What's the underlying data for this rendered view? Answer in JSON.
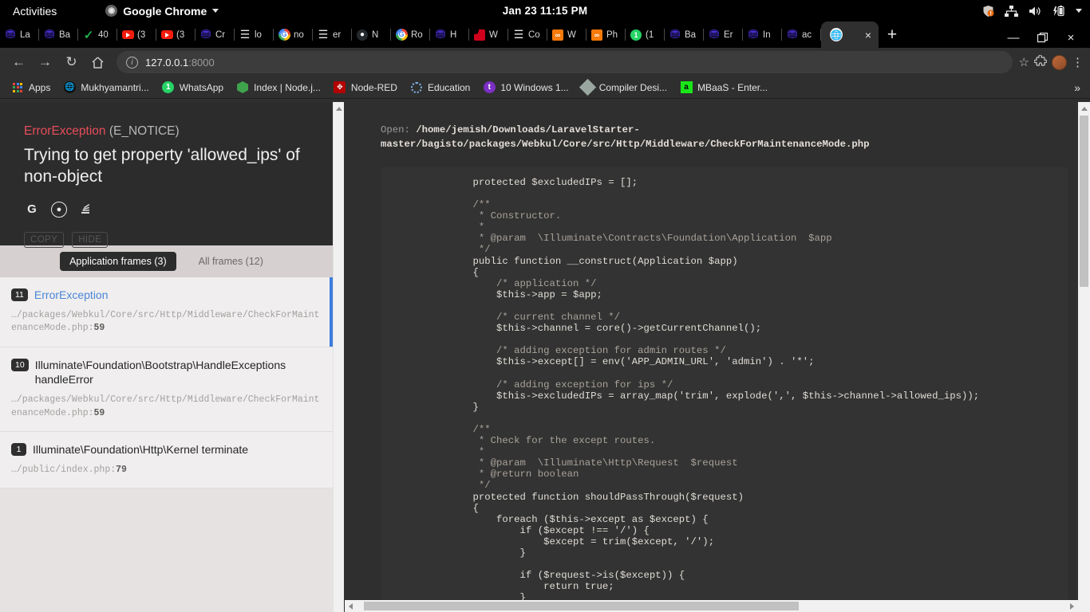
{
  "desktop": {
    "activities": "Activities",
    "app_menu": "Google Chrome",
    "clock": "Jan 23  11:15 PM",
    "tray_icons": [
      "shield-alert-icon",
      "network-icon",
      "volume-icon",
      "battery-charging-icon",
      "dropdown-arrow-icon"
    ]
  },
  "browser": {
    "tabs": [
      {
        "label": "La",
        "icon": "castle-favicon"
      },
      {
        "label": "Ba",
        "icon": "castle-favicon"
      },
      {
        "label": "40",
        "icon": "green-check-favicon"
      },
      {
        "label": "(3",
        "icon": "youtube-favicon"
      },
      {
        "label": "(3",
        "icon": "youtube-favicon"
      },
      {
        "label": "Cr",
        "icon": "castle-favicon"
      },
      {
        "label": "lo",
        "icon": "stackoverflow-favicon"
      },
      {
        "label": "no",
        "icon": "google-favicon"
      },
      {
        "label": "er",
        "icon": "stackoverflow-favicon"
      },
      {
        "label": "N",
        "icon": "github-favicon"
      },
      {
        "label": "Ro",
        "icon": "google-favicon"
      },
      {
        "label": "H",
        "icon": "castle-favicon"
      },
      {
        "label": "W",
        "icon": "red-favicon"
      },
      {
        "label": "Co",
        "icon": "stackoverflow-favicon"
      },
      {
        "label": "W",
        "icon": "xampp-favicon"
      },
      {
        "label": "Ph",
        "icon": "xampp-favicon"
      },
      {
        "label": "(1",
        "icon": "whatsapp-favicon"
      },
      {
        "label": "Ba",
        "icon": "castle-favicon"
      },
      {
        "label": "Er",
        "icon": "castle-favicon"
      },
      {
        "label": "In",
        "icon": "castle-favicon"
      },
      {
        "label": "ac",
        "icon": "castle-favicon"
      }
    ],
    "active_tab": {
      "label": "",
      "icon": "globe-favicon",
      "close": "×"
    },
    "new_tab_label": "+",
    "window_controls": {
      "minimize": "—",
      "maximize": "❐",
      "close": "×"
    },
    "nav": {
      "back": "←",
      "forward": "→",
      "reload": "↻",
      "home": "⌂"
    },
    "omnibox": {
      "site_info_icon": "info-icon",
      "url_host": "127.0.0.1",
      "url_port": ":8000"
    },
    "toolbar_right": {
      "bookmark_star": "☆",
      "extensions": "extensions-puzzle-icon",
      "profile": "avatar",
      "menu": "⋮"
    },
    "bookmarks": [
      {
        "label": "Apps",
        "icon": "apps-grid-icon"
      },
      {
        "label": "Mukhyamantri...",
        "icon": "globe-dark-icon"
      },
      {
        "label": "WhatsApp",
        "icon": "whatsapp-icon"
      },
      {
        "label": "Index | Node.j...",
        "icon": "nodejs-hex-icon"
      },
      {
        "label": "Node-RED",
        "icon": "node-red-icon"
      },
      {
        "label": "Education",
        "icon": "education-dotted-icon"
      },
      {
        "label": "10 Windows 1...",
        "icon": "purple-circle-icon"
      },
      {
        "label": "Compiler Desi...",
        "icon": "diamond-icon"
      },
      {
        "label": "MBaaS - Enter...",
        "icon": "mbaas-green-icon"
      }
    ],
    "bookmarks_overflow": "»"
  },
  "error_page": {
    "exception_class": "ErrorException",
    "exception_level": "(E_NOTICE)",
    "message": "Trying to get property 'allowed_ips' of non-object",
    "search_links": [
      {
        "name": "google-search-icon",
        "glyph": "G"
      },
      {
        "name": "duckduckgo-search-icon",
        "glyph": "ⓘ"
      },
      {
        "name": "stackoverflow-search-icon",
        "glyph": "≣"
      }
    ],
    "copy_label": "COPY",
    "hide_label": "HIDE",
    "frame_tabs": [
      {
        "label": "Application frames (3)",
        "selected": true
      },
      {
        "label": "All frames (12)",
        "selected": false
      }
    ],
    "frames": [
      {
        "num": "11",
        "name": "ErrorException",
        "highlight": true,
        "selected": true,
        "path": "…/packages/Webkul/Core/src/Http/Middleware/CheckForMaintenanceMode.php:",
        "line": "59"
      },
      {
        "num": "10",
        "name": "Illuminate\\Foundation\\Bootstrap\\HandleExceptions handleError",
        "highlight": false,
        "selected": false,
        "path": "…/packages/Webkul/Core/src/Http/Middleware/CheckForMaintenanceMode.php:",
        "line": "59"
      },
      {
        "num": "1",
        "name": "Illuminate\\Foundation\\Http\\Kernel terminate",
        "highlight": false,
        "selected": false,
        "path": "…/public/index.php:",
        "line": "79"
      }
    ],
    "open_label": "Open:",
    "open_path": "/home/jemish/Downloads/LaravelStarter-master/bagisto/packages/Webkul/Core/src/Http/Middleware/CheckForMaintenanceMode.php",
    "code": "    protected $excludedIPs = [];\n\n    /**\n     * Constructor.\n     *\n     * @param  \\Illuminate\\Contracts\\Foundation\\Application  $app\n     */\n    public function __construct(Application $app)\n    {\n        /* application */\n        $this->app = $app;\n\n        /* current channel */\n        $this->channel = core()->getCurrentChannel();\n\n        /* adding exception for admin routes */\n        $this->except[] = env('APP_ADMIN_URL', 'admin') . '*';\n\n        /* adding exception for ips */\n        $this->excludedIPs = array_map('trim', explode(',', $this->channel->allowed_ips));\n    }\n\n    /**\n     * Check for the except routes.\n     *\n     * @param  \\Illuminate\\Http\\Request  $request\n     * @return boolean\n     */\n    protected function shouldPassThrough($request)\n    {\n        foreach ($this->except as $except) {\n            if ($except !== '/') {\n                $except = trim($except, '/');\n            }\n\n            if ($request->is($except)) {\n                return true;\n            }\n        }"
  }
}
